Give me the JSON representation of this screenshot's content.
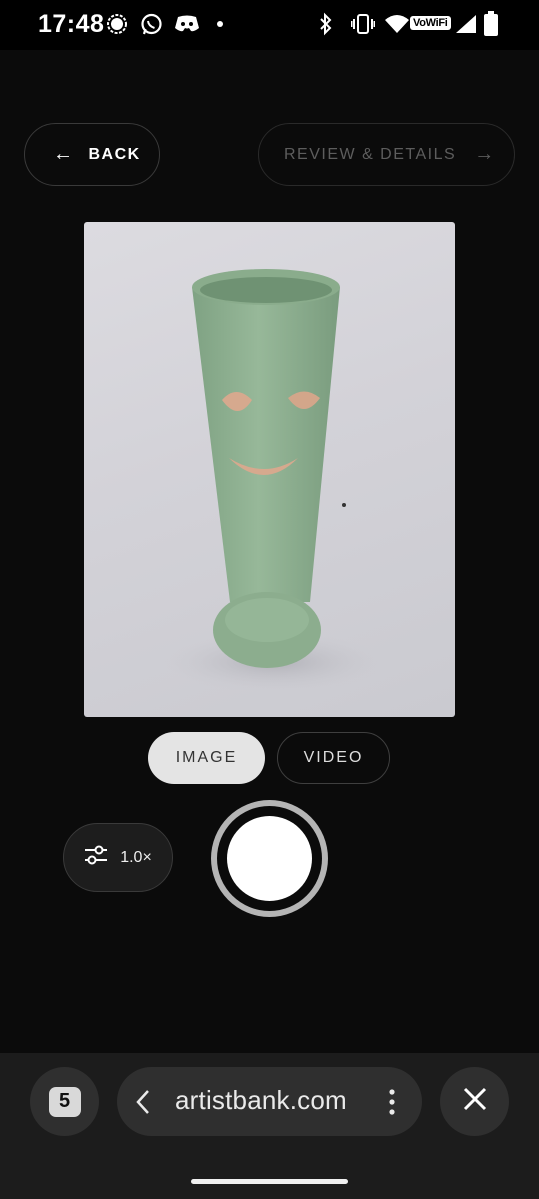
{
  "status_bar": {
    "time": "17:48",
    "left_icons": [
      "signal-messenger-icon",
      "whatsapp-icon",
      "discord-icon",
      "dot-icon"
    ],
    "right_icons": [
      "bluetooth-icon",
      "vibrate-icon",
      "wifi-icon",
      "vowifi-icon",
      "cell-signal-icon",
      "battery-icon"
    ],
    "vowifi_label": "VoWiFi"
  },
  "nav": {
    "back_label": "BACK",
    "back_arrow": "←",
    "review_label": "REVIEW & DETAILS",
    "review_arrow": "→"
  },
  "preview": {
    "subject_icon": "green-ceramic-vase-with-smiling-face"
  },
  "mode": {
    "image_label": "IMAGE",
    "video_label": "VIDEO",
    "selected": "IMAGE"
  },
  "camera": {
    "zoom_label": "1.0×",
    "settings_icon": "sliders-icon",
    "shutter_icon": "shutter-icon"
  },
  "browser": {
    "tab_count": "5",
    "url": "artistbank.com",
    "icons": [
      "chevron-left-icon",
      "more-vert-icon",
      "close-icon"
    ]
  },
  "colors": {
    "background": "#0b0b0b",
    "selected_mode_bg": "#e4e4e4",
    "vase_green": "#8fb191",
    "face_clay": "#d6a98e"
  }
}
